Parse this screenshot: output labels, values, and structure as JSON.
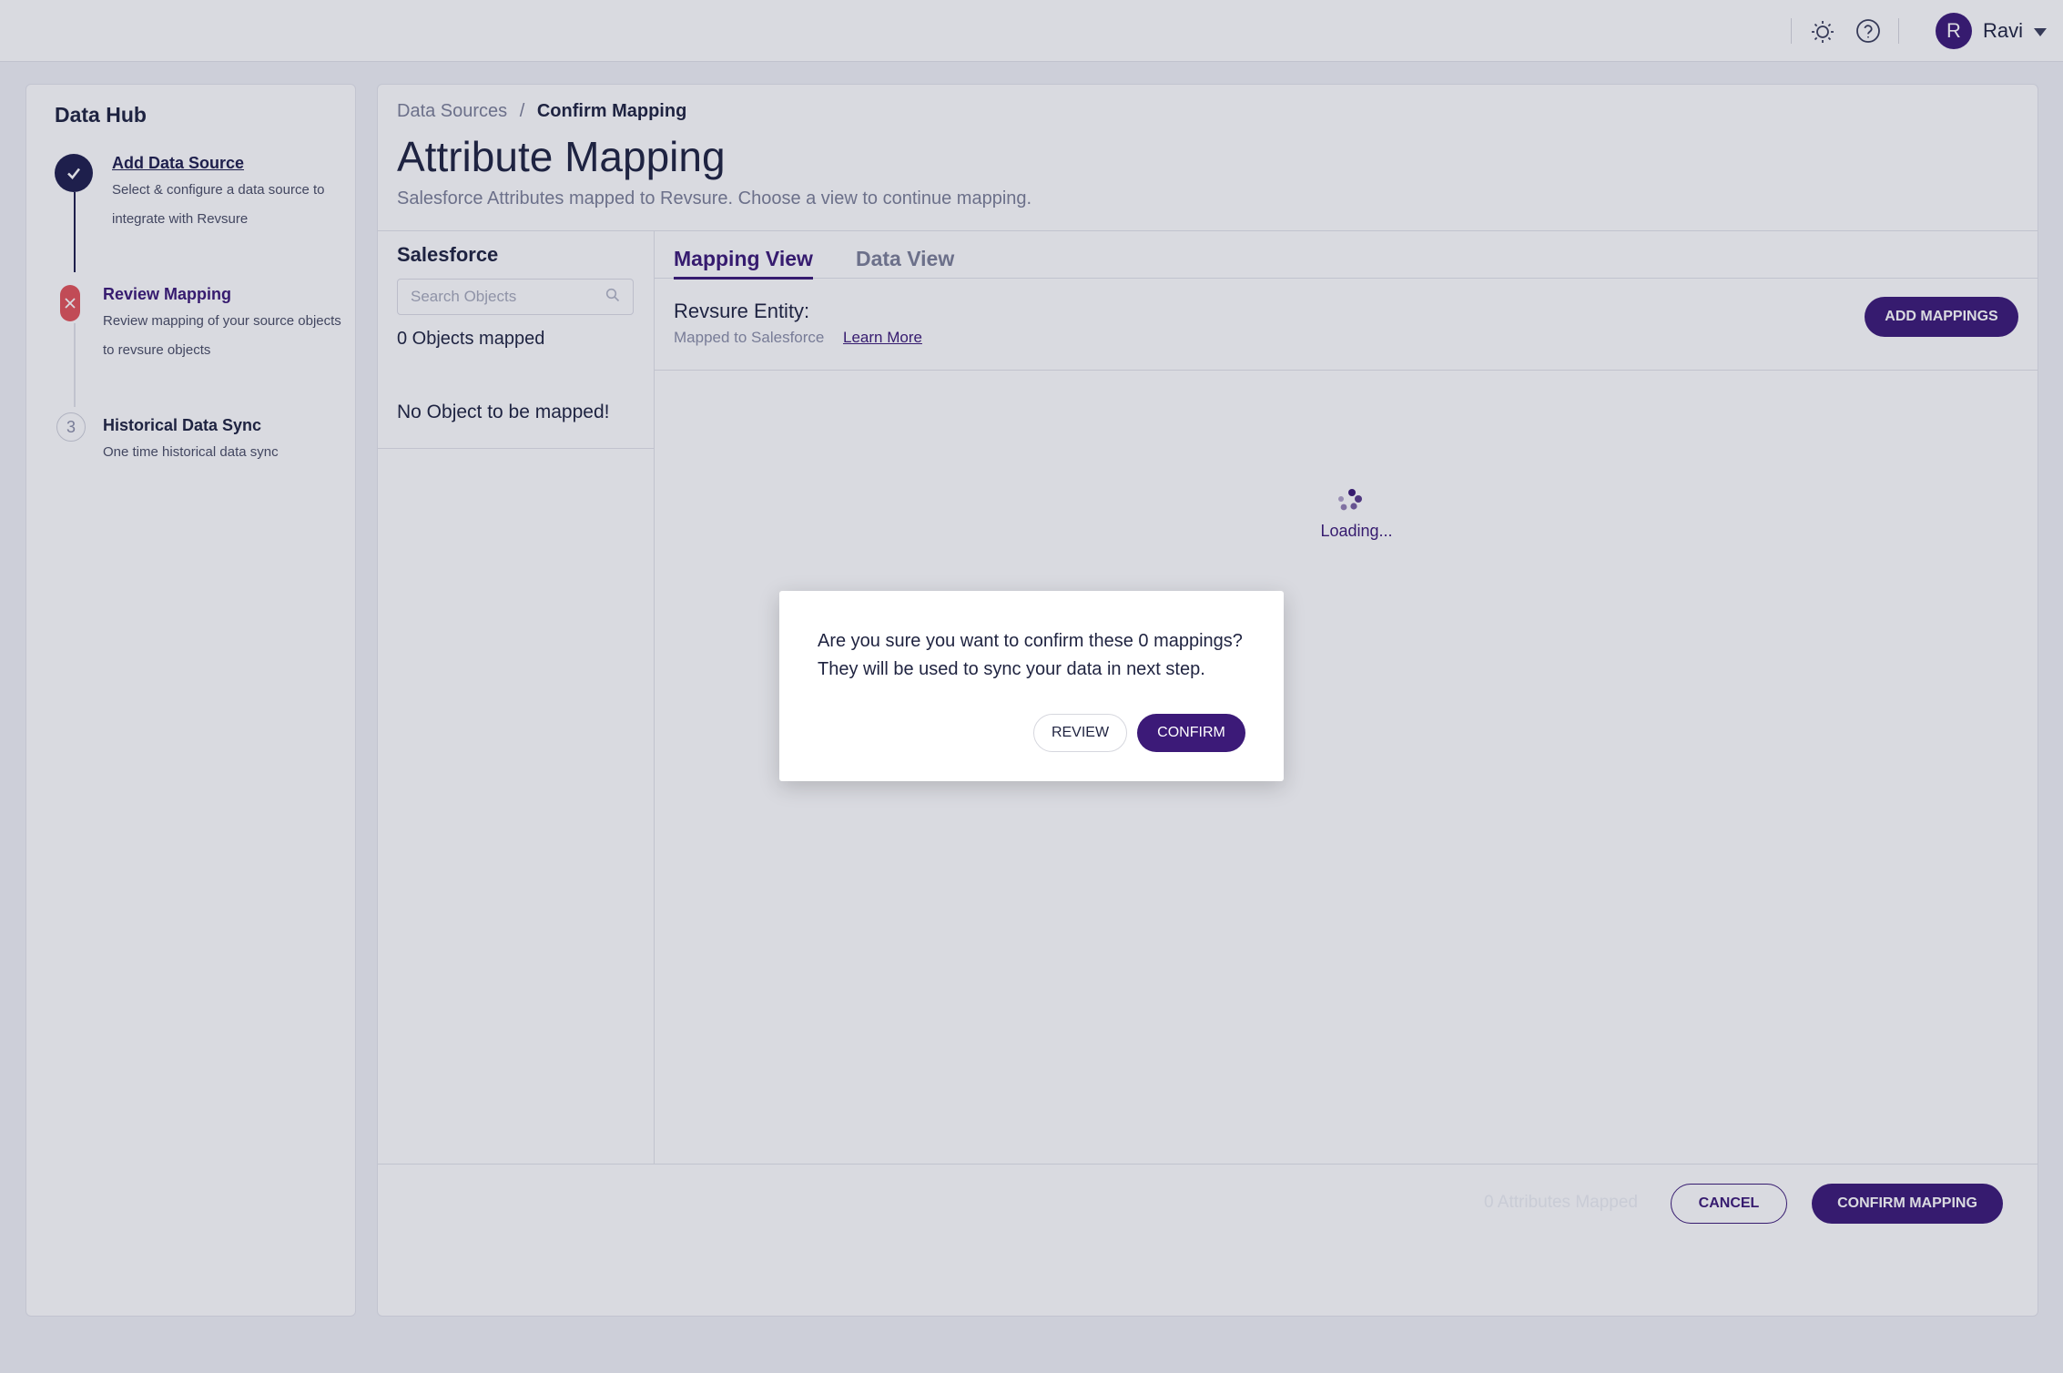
{
  "header": {
    "theme_icon": "sun-icon",
    "help_icon": "help-circle-icon",
    "user": {
      "initial": "R",
      "name": "Ravi"
    }
  },
  "steps": {
    "title": "Data Hub",
    "items": [
      {
        "title": "Add Data Source",
        "description": "Select & configure a data source to integrate with Revsure",
        "status": "complete"
      },
      {
        "title": "Review Mapping",
        "description": "Review mapping of your source objects to revsure objects",
        "status": "error"
      },
      {
        "number": "3",
        "title": "Historical Data Sync",
        "description": "One time historical data sync",
        "status": "pending"
      }
    ]
  },
  "breadcrumb": {
    "parent": "Data Sources",
    "separator": "/",
    "current": "Confirm Mapping"
  },
  "page": {
    "title": "Attribute Mapping",
    "subtitle": "Salesforce Attributes mapped to Revsure. Choose a view to continue mapping."
  },
  "source": {
    "title": "Salesforce",
    "search_placeholder": "Search Objects",
    "objects_mapped": "0 Objects mapped",
    "empty_text": "No Object to be mapped!"
  },
  "tabs": [
    {
      "label": "Mapping View",
      "active": true
    },
    {
      "label": "Data View",
      "active": false
    }
  ],
  "entity": {
    "title": "Revsure Entity:",
    "subtitle": "Mapped to Salesforce",
    "learn_more": "Learn More",
    "add_button": "ADD MAPPINGS"
  },
  "loading": {
    "text": "Loading..."
  },
  "footer": {
    "attributes_mapped": "0 Attributes Mapped",
    "cancel": "CANCEL",
    "confirm": "CONFIRM MAPPING"
  },
  "dialog": {
    "message": "Are you sure you want to confirm these 0 mappings? They will be used to sync your data in next step.",
    "review": "REVIEW",
    "confirm": "CONFIRM"
  },
  "colors": {
    "primary": "#3c1a78",
    "step_complete": "#1f1f4d",
    "step_error": "#e3545a"
  }
}
